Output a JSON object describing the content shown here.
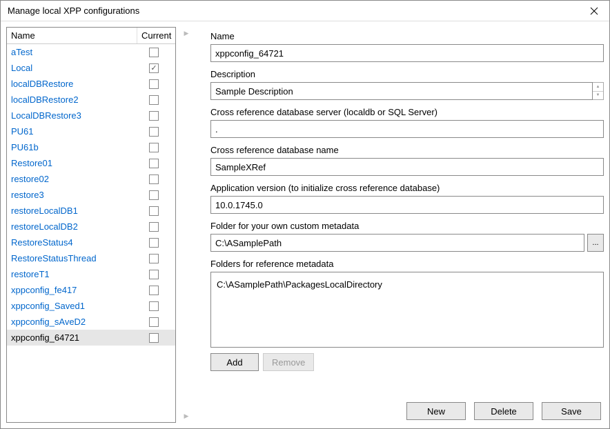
{
  "window": {
    "title": "Manage local XPP configurations"
  },
  "list": {
    "header_name": "Name",
    "header_current": "Current",
    "rows": [
      {
        "name": "aTest",
        "current": false,
        "selected": false
      },
      {
        "name": "Local",
        "current": true,
        "selected": false
      },
      {
        "name": "localDBRestore",
        "current": false,
        "selected": false
      },
      {
        "name": "localDBRestore2",
        "current": false,
        "selected": false
      },
      {
        "name": "LocalDBRestore3",
        "current": false,
        "selected": false
      },
      {
        "name": "PU61",
        "current": false,
        "selected": false
      },
      {
        "name": "PU61b",
        "current": false,
        "selected": false
      },
      {
        "name": "Restore01",
        "current": false,
        "selected": false
      },
      {
        "name": "restore02",
        "current": false,
        "selected": false
      },
      {
        "name": "restore3",
        "current": false,
        "selected": false
      },
      {
        "name": "restoreLocalDB1",
        "current": false,
        "selected": false
      },
      {
        "name": "restoreLocalDB2",
        "current": false,
        "selected": false
      },
      {
        "name": "RestoreStatus4",
        "current": false,
        "selected": false
      },
      {
        "name": "RestoreStatusThread",
        "current": false,
        "selected": false
      },
      {
        "name": "restoreT1",
        "current": false,
        "selected": false
      },
      {
        "name": "xppconfig_fe417",
        "current": false,
        "selected": false
      },
      {
        "name": "xppconfig_Saved1",
        "current": false,
        "selected": false
      },
      {
        "name": "xppconfig_sAveD2",
        "current": false,
        "selected": false
      },
      {
        "name": "xppconfig_64721",
        "current": false,
        "selected": true
      }
    ]
  },
  "form": {
    "name_label": "Name",
    "name_value": "xppconfig_64721",
    "description_label": "Description",
    "description_value": "Sample Description",
    "xref_server_label": "Cross reference database server (localdb or SQL Server)",
    "xref_server_value": ".",
    "xref_db_label": "Cross reference database name",
    "xref_db_value": "SampleXRef",
    "app_version_label": "Application version (to initialize cross reference database)",
    "app_version_value": "10.0.1745.0",
    "custom_folder_label": "Folder for your own custom metadata",
    "custom_folder_value": "C:\\ASamplePath",
    "ref_folders_label": "Folders for reference metadata",
    "ref_folders": [
      "C:\\ASamplePath\\PackagesLocalDirectory"
    ],
    "browse_label": "..."
  },
  "buttons": {
    "add": "Add",
    "remove": "Remove",
    "new": "New",
    "delete": "Delete",
    "save": "Save"
  }
}
